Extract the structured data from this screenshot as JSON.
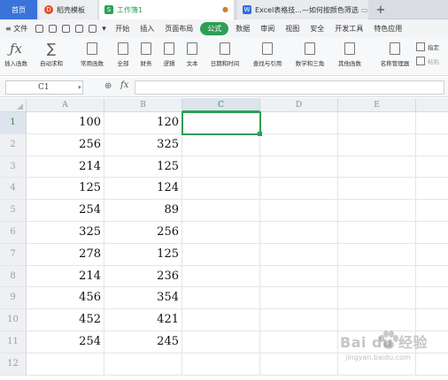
{
  "tabs": {
    "home": "首页",
    "template": "稻壳模板",
    "workbook": "工作簿1",
    "excel": "Excel表格技...—如何按颜色筛选",
    "add": "+"
  },
  "menu": {
    "file": "≡ 文件",
    "items": [
      "开始",
      "插入",
      "页面布局",
      "公式",
      "数据",
      "审阅",
      "视图",
      "安全",
      "开发工具",
      "特色应用"
    ],
    "active": "公式"
  },
  "ribbon": {
    "insert_function": "插入函数",
    "autosum": "自动求和",
    "common_functions": "常用函数",
    "all": "全部",
    "financial": "财务",
    "logical": "逻辑",
    "text": "文本",
    "datetime": "日期和时间",
    "lookup": "查找与引用",
    "math": "数学和三角",
    "other": "其他函数",
    "name_manager": "名称管理器",
    "specify": "指定",
    "paste": "粘贴"
  },
  "formula_bar": {
    "cell_ref": "C1",
    "fx": "fx",
    "value": ""
  },
  "sheet": {
    "columns": [
      "A",
      "B",
      "C",
      "D",
      "E"
    ],
    "selected_column": "C",
    "rows": [
      {
        "row": "1",
        "a": "100",
        "b": "120"
      },
      {
        "row": "2",
        "a": "256",
        "b": "325"
      },
      {
        "row": "3",
        "a": "214",
        "b": "125"
      },
      {
        "row": "4",
        "a": "125",
        "b": "124"
      },
      {
        "row": "5",
        "a": "254",
        "b": "89"
      },
      {
        "row": "6",
        "a": "325",
        "b": "256"
      },
      {
        "row": "7",
        "a": "278",
        "b": "125"
      },
      {
        "row": "8",
        "a": "214",
        "b": "236"
      },
      {
        "row": "9",
        "a": "456",
        "b": "354"
      },
      {
        "row": "10",
        "a": "452",
        "b": "421"
      },
      {
        "row": "11",
        "a": "254",
        "b": "245"
      },
      {
        "row": "12",
        "a": "",
        "b": ""
      }
    ]
  },
  "watermark": {
    "main": "Bai du 经验",
    "sub": "jingyan.baidu.com"
  },
  "colors": {
    "accent_green": "#2e9e55",
    "home_tab_blue": "#3a73d9"
  }
}
